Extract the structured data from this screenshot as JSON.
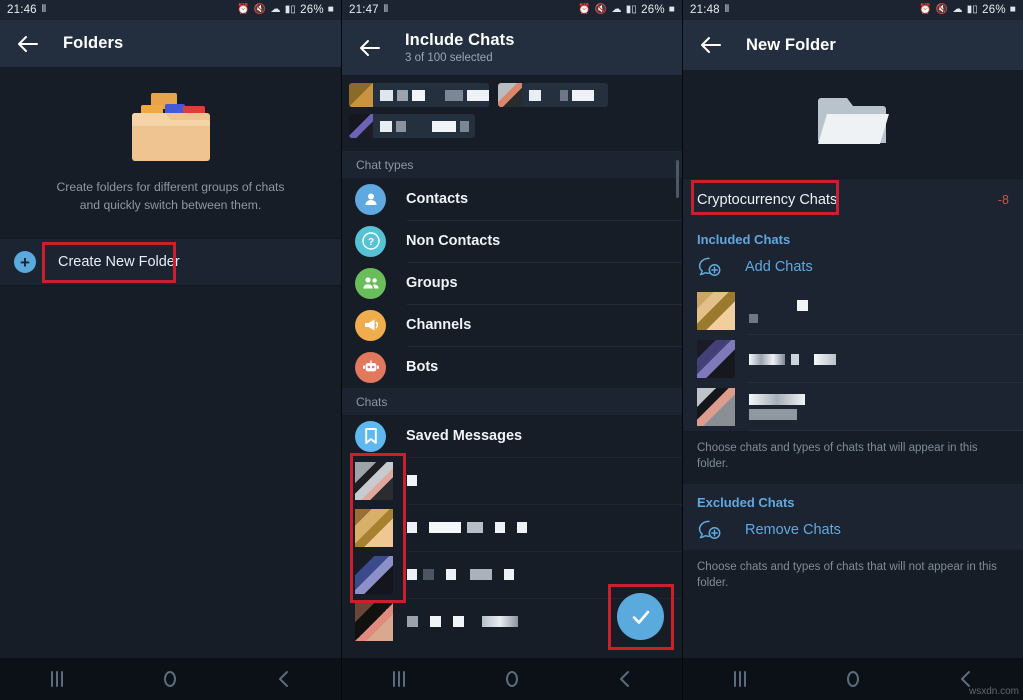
{
  "panels": [
    {
      "status": {
        "time": "21:46",
        "extra": "⦀",
        "battery": "26%"
      },
      "appbar": {
        "title": "Folders",
        "back_icon": "arrow-left-icon"
      },
      "empty": {
        "illustration": "folders-illustration",
        "text": "Create folders for different groups of chats and quickly switch between them."
      },
      "create_new_folder": {
        "label": "Create New Folder",
        "icon": "plus-circle-icon",
        "highlighted": true
      }
    },
    {
      "status": {
        "time": "21:47",
        "extra": "⦀",
        "battery": "26%"
      },
      "appbar": {
        "title": "Include Chats",
        "subtitle": "3 of 100 selected",
        "back_icon": "arrow-left-icon"
      },
      "selected_chips": [
        {
          "name": "chat-chip-1"
        },
        {
          "name": "chat-chip-2"
        },
        {
          "name": "chat-chip-3"
        }
      ],
      "sections": [
        {
          "header": "Chat types",
          "items": [
            {
              "label": "Contacts",
              "icon": "person-icon",
              "color": "#5fa8e0",
              "cls": "c-contacts"
            },
            {
              "label": "Non Contacts",
              "icon": "question-icon",
              "color": "#56c2d6",
              "cls": "c-noncontacts"
            },
            {
              "label": "Groups",
              "icon": "group-icon",
              "color": "#69bd5a",
              "cls": "c-groups"
            },
            {
              "label": "Channels",
              "icon": "megaphone-icon",
              "color": "#f0ad4e",
              "cls": "c-channels"
            },
            {
              "label": "Bots",
              "icon": "robot-icon",
              "color": "#e2785e",
              "cls": "c-bots"
            }
          ]
        },
        {
          "header": "Chats",
          "items": [
            {
              "label": "Saved Messages",
              "icon": "bookmark-icon",
              "color": "#5fb9ef",
              "cls": "c-saved"
            }
          ]
        }
      ],
      "redacted_chats_highlighted": true,
      "confirm_fab": {
        "icon": "check-icon",
        "color": "#5aaade",
        "highlighted": true
      }
    },
    {
      "status": {
        "time": "21:48",
        "extra": "⦀",
        "battery": "26%"
      },
      "appbar": {
        "title": "New Folder",
        "back_icon": "arrow-left-icon"
      },
      "folder_illustration": "folder-illustration",
      "folder_name": {
        "value": "Cryptocurrency Chats",
        "counter": "-8",
        "counter_color": "#c8563f",
        "highlighted": true
      },
      "included": {
        "header": "Included Chats",
        "action": {
          "label": "Add Chats",
          "icon": "chat-plus-icon"
        },
        "hint": "Choose chats and types of chats that will appear in this folder."
      },
      "excluded": {
        "header": "Excluded Chats",
        "action": {
          "label": "Remove Chats",
          "icon": "chat-plus-icon"
        },
        "hint": "Choose chats and types of chats that will not appear in this folder."
      }
    }
  ],
  "navbar": {
    "recents": "recents-icon",
    "home": "home-icon",
    "back": "back-icon"
  },
  "watermark": "wsxdn.com"
}
